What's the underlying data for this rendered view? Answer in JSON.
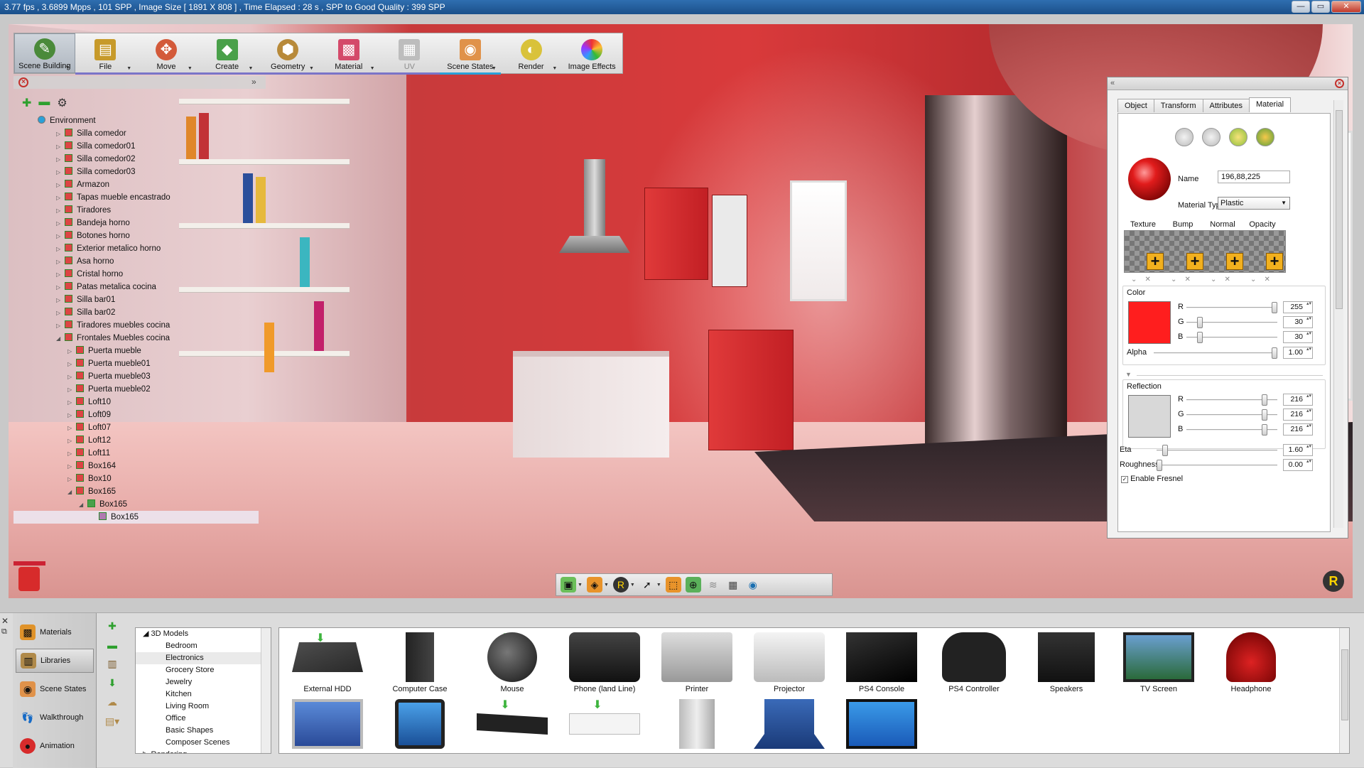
{
  "titlebar": {
    "status": "3.77 fps ,  3.6899 Mpps ,  101 SPP   , Image Size [ 1891 X 808 ] , Time Elapsed : 28 s , SPP to Good Quality : 399 SPP",
    "min_label": "—",
    "max_label": "▭",
    "close_label": "✕"
  },
  "toolbar": {
    "items": [
      {
        "label": "Scene Building",
        "icon": "scene-building-icon"
      },
      {
        "label": "File",
        "icon": "file-icon"
      },
      {
        "label": "Move",
        "icon": "move-icon"
      },
      {
        "label": "Create",
        "icon": "create-icon"
      },
      {
        "label": "Geometry",
        "icon": "geometry-icon"
      },
      {
        "label": "Material",
        "icon": "material-icon"
      },
      {
        "label": "UV",
        "icon": "uv-icon"
      },
      {
        "label": "Scene States",
        "icon": "scene-states-icon"
      },
      {
        "label": "Render",
        "icon": "render-icon"
      },
      {
        "label": "Image Effects",
        "icon": "image-effects-icon"
      }
    ]
  },
  "scene_tree": {
    "root": "Environment",
    "items": [
      "Silla comedor",
      "Silla comedor01",
      "Silla comedor02",
      "Silla comedor03",
      "Armazon",
      "Tapas mueble encastrado",
      "Tiradores",
      "Bandeja horno",
      "Botones horno",
      "Exterior metalico horno",
      "Asa horno",
      "Cristal horno",
      "Patas metalica cocina",
      "Silla bar01",
      "Silla bar02",
      "Tiradores muebles cocina",
      "Frontales Muebles cocina"
    ],
    "children": [
      "Puerta mueble",
      "Puerta mueble01",
      "Puerta mueble03",
      "Puerta mueble02",
      "Loft10",
      "Loft09",
      "Loft07",
      "Loft12",
      "Loft11",
      "Box164",
      "Box10",
      "Box165"
    ],
    "grandchild": "Box165",
    "selected": "Box165"
  },
  "material_panel": {
    "tabs": [
      "Object",
      "Transform",
      "Attributes",
      "Material"
    ],
    "active_tab": "Material",
    "name_label": "Name",
    "name_value": "196,88,225",
    "material_type_label": "Material Type",
    "material_type_value": "Plastic",
    "texture_slots": [
      "Texture",
      "Bump",
      "Normal",
      "Opacity"
    ],
    "color": {
      "label": "Color",
      "r_label": "R",
      "g_label": "G",
      "b_label": "B",
      "r": "255",
      "g": "30",
      "b": "30",
      "swatch": "#ff1e1e",
      "alpha_label": "Alpha",
      "alpha": "1.00"
    },
    "reflection": {
      "label": "Reflection",
      "r_label": "R",
      "g_label": "G",
      "b_label": "B",
      "r": "216",
      "g": "216",
      "b": "216",
      "swatch": "#d8d8d8"
    },
    "eta_label": "Eta",
    "eta": "1.60",
    "roughness_label": "Roughness",
    "roughness": "0.00",
    "fresnel_label": "Enable Fresnel"
  },
  "bottom_nav": {
    "items": [
      "Materials",
      "Libraries",
      "Scene States",
      "Walkthrough",
      "Animation"
    ],
    "active": "Libraries"
  },
  "library_tree": {
    "root": "3D Models",
    "items": [
      "Bedroom",
      "Electronics",
      "Grocery Store",
      "Jewelry",
      "Kitchen",
      "Living Room",
      "Office",
      "Basic Shapes",
      "Composer Scenes"
    ],
    "selected": "Electronics",
    "next_root": "Rendering"
  },
  "library_items": [
    "External HDD",
    "Computer Case",
    "Mouse",
    "Phone (land Line)",
    "Printer",
    "Projector",
    "PS4 Console",
    "PS4 Controller",
    "Speakers",
    "TV Screen",
    "Headphone"
  ],
  "colors": {
    "accent_bar": "#7a74c8",
    "wall_red": "#d93a3b",
    "close_red": "#c4302b"
  }
}
